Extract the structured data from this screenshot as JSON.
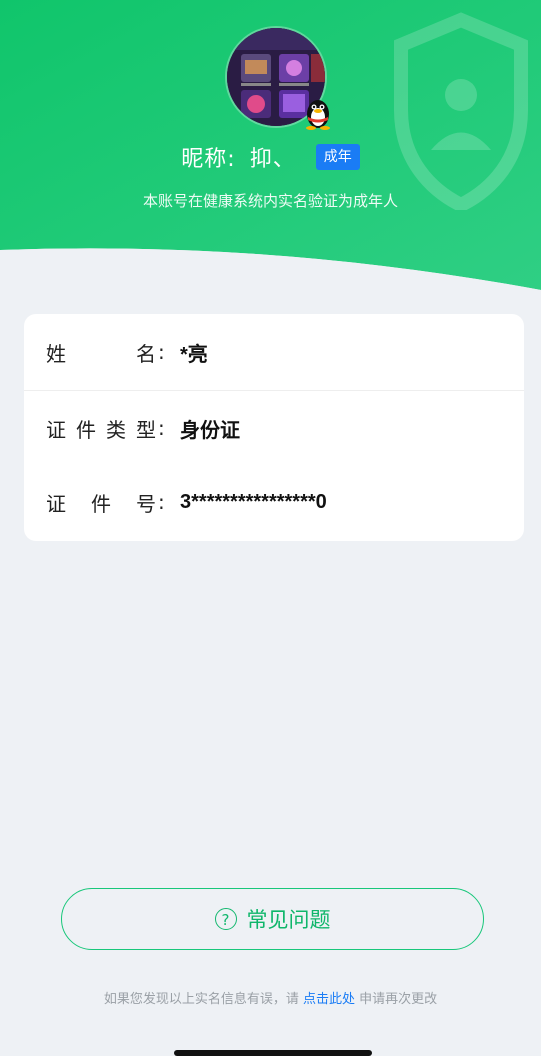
{
  "header": {
    "nickname_label": "昵称:",
    "nickname_value": "抑、",
    "age_badge": "成年",
    "verification_text": "本账号在健康系统内实名验证为成年人"
  },
  "info": {
    "rows": [
      {
        "label_chars": [
          "姓",
          "名"
        ],
        "value": "*亮"
      },
      {
        "label_chars": [
          "证",
          "件",
          "类",
          "型"
        ],
        "value": "身份证"
      },
      {
        "label_chars": [
          "证",
          "件",
          "号"
        ],
        "value": "3****************0"
      }
    ]
  },
  "faq": {
    "icon_symbol": "?",
    "label": "常见问题"
  },
  "footer": {
    "prefix": "如果您发现以上实名信息有误，请",
    "link": "点击此处",
    "suffix": "申请再次更改"
  },
  "colors": {
    "header_green": "#13c46e",
    "badge_blue": "#1a7cf5",
    "link_blue": "#1a7cf5",
    "faq_green": "#0fb66a",
    "background": "#eef1f5"
  },
  "icons": {
    "shield": "shield-icon",
    "qq": "qq-penguin-icon",
    "faq": "question-circle-icon"
  }
}
